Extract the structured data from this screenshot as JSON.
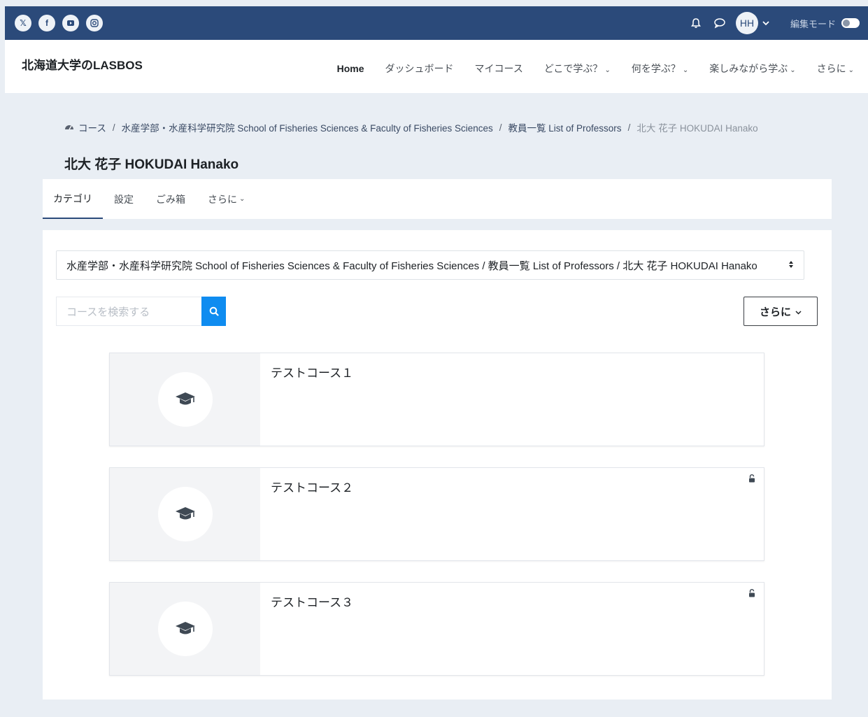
{
  "social": [
    {
      "name": "x",
      "glyph": "𝕏"
    },
    {
      "name": "facebook",
      "glyph": "f"
    },
    {
      "name": "youtube",
      "glyph": "▶"
    },
    {
      "name": "instagram",
      "glyph": "◎"
    }
  ],
  "user": {
    "initials": "HH"
  },
  "edit_mode_label": "編集モード",
  "brand": "北海道大学のLASBOS",
  "nav": {
    "home": "Home",
    "dashboard": "ダッシュボード",
    "mycourses": "マイコース",
    "where": "どこで学ぶ？",
    "what": "何を学ぶ？",
    "fun": "楽しみながら学ぶ",
    "more": "さらに"
  },
  "breadcrumb": {
    "b1": "コース",
    "b2": "水産学部・水産科学研究院 School of Fisheries Sciences & Faculty of Fisheries Sciences",
    "b3": "教員一覧 List of Professors",
    "b4": "北大 花子 HOKUDAI Hanako"
  },
  "page_title": "北大 花子 HOKUDAI Hanako",
  "secnav": {
    "category": "カテゴリ",
    "settings": "設定",
    "trash": "ごみ箱",
    "more": "さらに"
  },
  "category_select": "水産学部・水産科学研究院 School of Fisheries Sciences & Faculty of Fisheries Sciences / 教員一覧 List of Professors / 北大 花子 HOKUDAI Hanako",
  "search": {
    "placeholder": "コースを検索する"
  },
  "more_button": "さらに",
  "courses": {
    "c1": "テストコース１",
    "c2": "テストコース２",
    "c3": "テストコース３"
  },
  "colors": {
    "topbar": "#2b4a7a",
    "search_button": "#0f8cf0",
    "background": "#e9eef4"
  }
}
